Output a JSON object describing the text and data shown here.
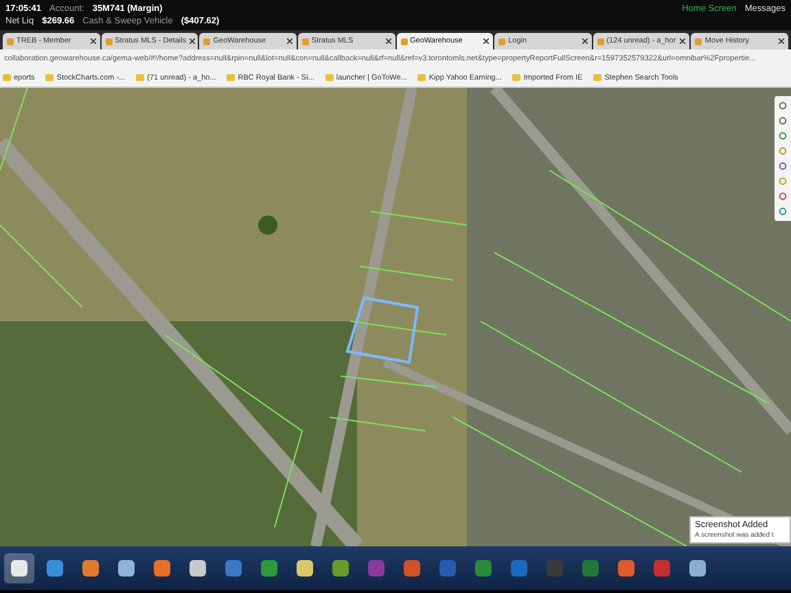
{
  "trading_bar": {
    "time": "17:05:41",
    "account_label": "Account:",
    "account": "35M741 (Margin)",
    "net_liq_label": "Net Liq",
    "net_liq": "$269.66",
    "cash_label": "Cash & Sweep Vehicle",
    "cash": "($407.62)",
    "home": "Home Screen",
    "messages": "Messages"
  },
  "tabs": [
    {
      "label": "TREB - Member",
      "selected": false
    },
    {
      "label": "Stratus MLS - Details",
      "selected": false
    },
    {
      "label": "GeoWarehouse",
      "selected": false
    },
    {
      "label": "Stratus MLS",
      "selected": false
    },
    {
      "label": "GeoWarehouse",
      "selected": true
    },
    {
      "label": "Login",
      "selected": false
    },
    {
      "label": "(124 unread) - a_hor",
      "selected": false
    },
    {
      "label": "Move History",
      "selected": false
    }
  ],
  "address_bar": {
    "url": "collaboration.geowarehouse.ca/gema-web/#!/home?address=null&rpin=null&lot=null&con=null&callback=null&rf=null&ref=v3.torontomls.net&type=propertyReportFullScreen&r=1597352579322&url=omnibar%2Fpropertie..."
  },
  "bookmarks": [
    "eports",
    "StockCharts.com -...",
    "(71 unread) - a_ho...",
    "RBC Royal Bank - Si...",
    "launcher | GoToWe...",
    "Kipp Yahoo Earning...",
    "Imported From IE",
    "Stephen Search Tools"
  ],
  "notification": {
    "title": "Screenshot Added",
    "body": "A screenshot was added t"
  }
}
